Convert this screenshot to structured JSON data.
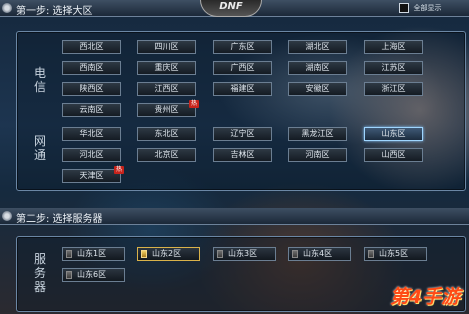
{
  "step1": {
    "title": "第一步: 选择大区",
    "show_all_label": "全部显示",
    "logo_text": "DNF"
  },
  "groups": {
    "dianxin_label": "电信",
    "wangtong_label": "网通"
  },
  "dianxin_regions": [
    {
      "label": "西北区",
      "hot": false,
      "selected": false
    },
    {
      "label": "四川区",
      "hot": false,
      "selected": false
    },
    {
      "label": "广东区",
      "hot": false,
      "selected": false
    },
    {
      "label": "湖北区",
      "hot": false,
      "selected": false
    },
    {
      "label": "上海区",
      "hot": false,
      "selected": false
    },
    {
      "label": "西南区",
      "hot": false,
      "selected": false
    },
    {
      "label": "重庆区",
      "hot": false,
      "selected": false
    },
    {
      "label": "广西区",
      "hot": false,
      "selected": false
    },
    {
      "label": "湖南区",
      "hot": false,
      "selected": false
    },
    {
      "label": "江苏区",
      "hot": false,
      "selected": false
    },
    {
      "label": "陕西区",
      "hot": false,
      "selected": false
    },
    {
      "label": "江西区",
      "hot": false,
      "selected": false
    },
    {
      "label": "福建区",
      "hot": false,
      "selected": false
    },
    {
      "label": "安徽区",
      "hot": false,
      "selected": false
    },
    {
      "label": "浙江区",
      "hot": false,
      "selected": false
    },
    {
      "label": "云南区",
      "hot": false,
      "selected": false
    },
    {
      "label": "贵州区",
      "hot": true,
      "selected": false
    }
  ],
  "wangtong_regions": [
    {
      "label": "华北区",
      "hot": false,
      "selected": false
    },
    {
      "label": "东北区",
      "hot": false,
      "selected": false
    },
    {
      "label": "辽宁区",
      "hot": false,
      "selected": false
    },
    {
      "label": "黑龙江区",
      "hot": false,
      "selected": false
    },
    {
      "label": "山东区",
      "hot": false,
      "selected": true
    },
    {
      "label": "河北区",
      "hot": false,
      "selected": false
    },
    {
      "label": "北京区",
      "hot": false,
      "selected": false
    },
    {
      "label": "吉林区",
      "hot": false,
      "selected": false
    },
    {
      "label": "河南区",
      "hot": false,
      "selected": false
    },
    {
      "label": "山西区",
      "hot": false,
      "selected": false
    },
    {
      "label": "天津区",
      "hot": true,
      "selected": false
    }
  ],
  "hot_badge_text": "热",
  "step2": {
    "title": "第二步: 选择服务器",
    "group_label": "服务器"
  },
  "servers": [
    {
      "label": "山东1区",
      "selected": false
    },
    {
      "label": "山东2区",
      "selected": true
    },
    {
      "label": "山东3区",
      "selected": false
    },
    {
      "label": "山东4区",
      "selected": false
    },
    {
      "label": "山东5区",
      "selected": false
    },
    {
      "label": "山东6区",
      "selected": false
    }
  ],
  "watermark_text": "第4手游",
  "colors": {
    "selected_border": "#9fd6ff",
    "hot_badge": "#c8231b",
    "server_selected": "#d9b24a"
  }
}
